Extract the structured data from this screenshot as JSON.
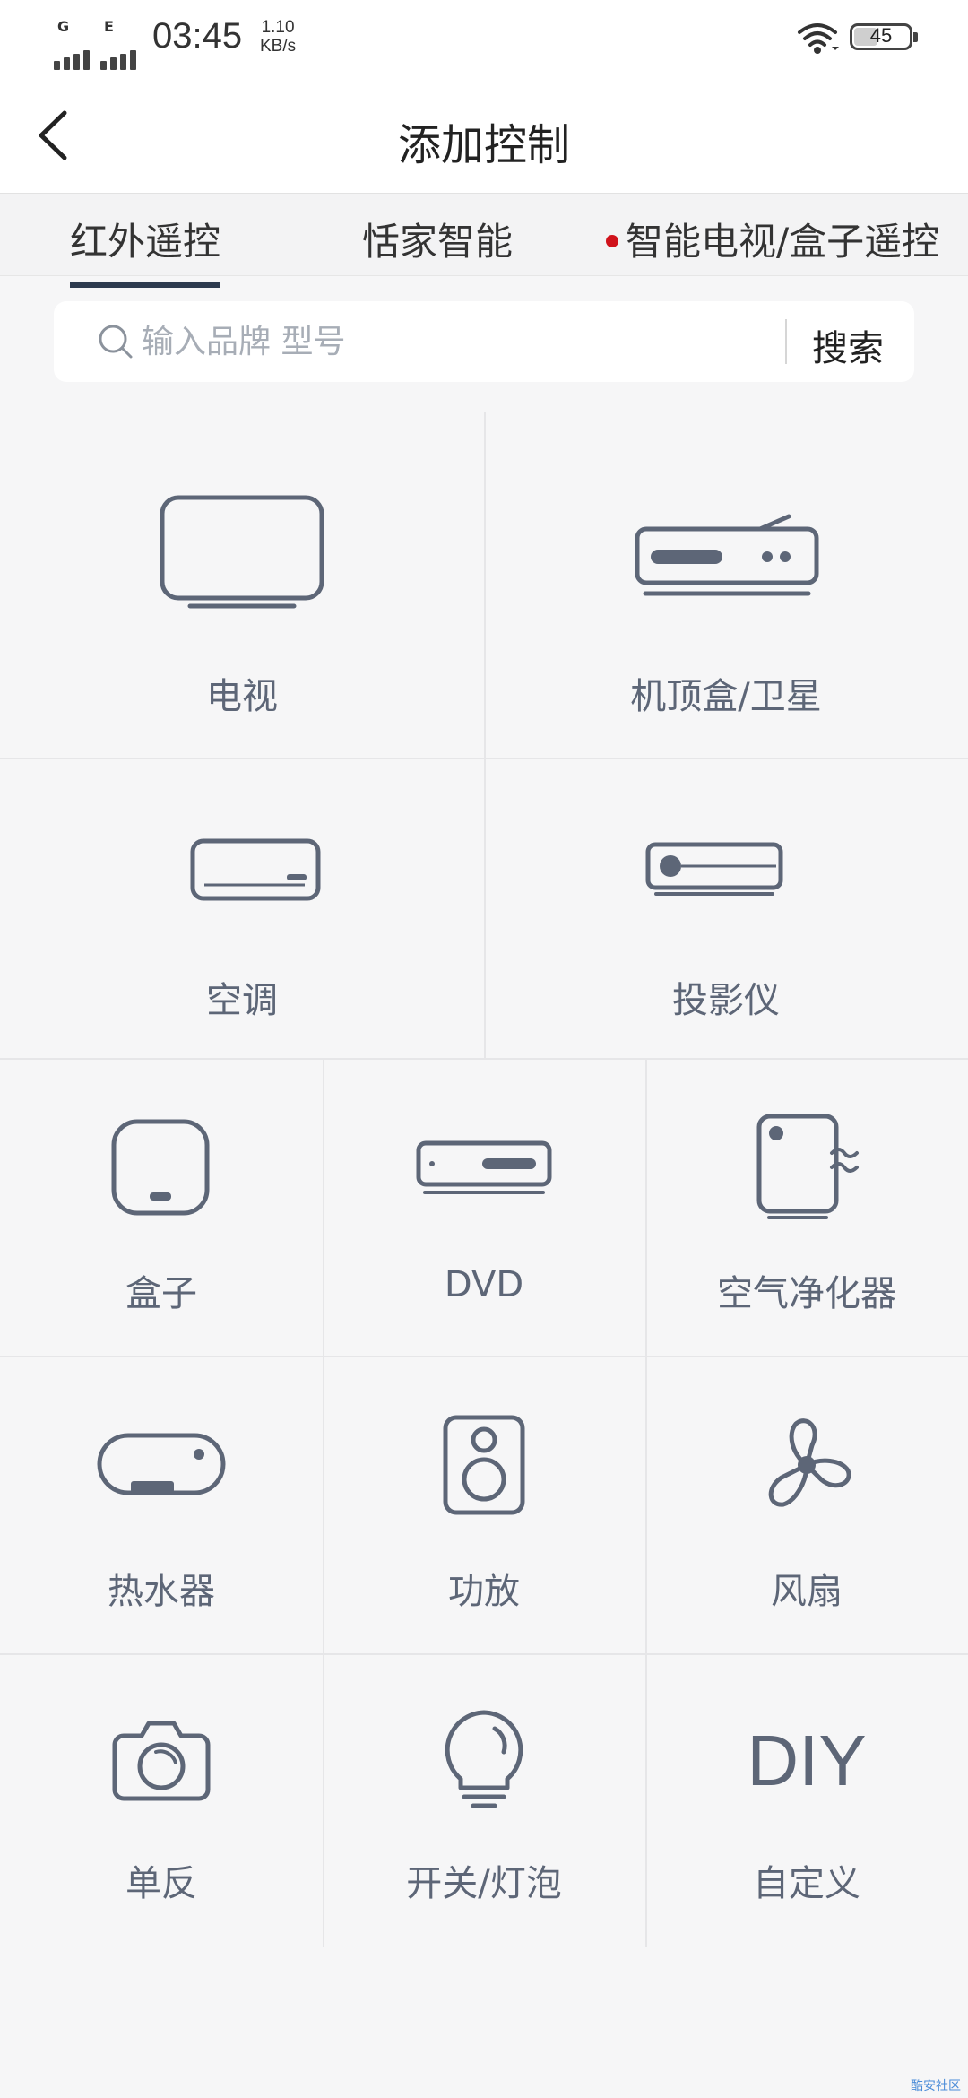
{
  "status_bar": {
    "network_1": "G",
    "network_2": "E",
    "time": "03:45",
    "speed_value": "1.10",
    "speed_unit": "KB/s",
    "battery_level": "45"
  },
  "header": {
    "title": "添加控制"
  },
  "tabs": [
    {
      "label": "红外遥控",
      "active": true
    },
    {
      "label": "恬家智能",
      "active": false
    },
    {
      "label": "智能电视/盒子遥控",
      "active": false,
      "badge": "red-dot"
    }
  ],
  "search": {
    "placeholder": "输入品牌 型号",
    "button_label": "搜索"
  },
  "devices": {
    "tv": "电视",
    "settop_box": "机顶盒/卫星",
    "air_conditioner": "空调",
    "projector": "投影仪",
    "box": "盒子",
    "dvd": "DVD",
    "air_purifier": "空气净化器",
    "water_heater": "热水器",
    "amplifier": "功放",
    "fan": "风扇",
    "camera": "单反",
    "switch_bulb": "开关/灯泡",
    "diy_text": "DIY",
    "custom": "自定义"
  },
  "footer_mark": "酷安社区",
  "colors": {
    "icon": "#5d6677",
    "tab_indicator": "#2d3a4e",
    "badge": "#d0121b",
    "background": "#f6f6f7"
  }
}
